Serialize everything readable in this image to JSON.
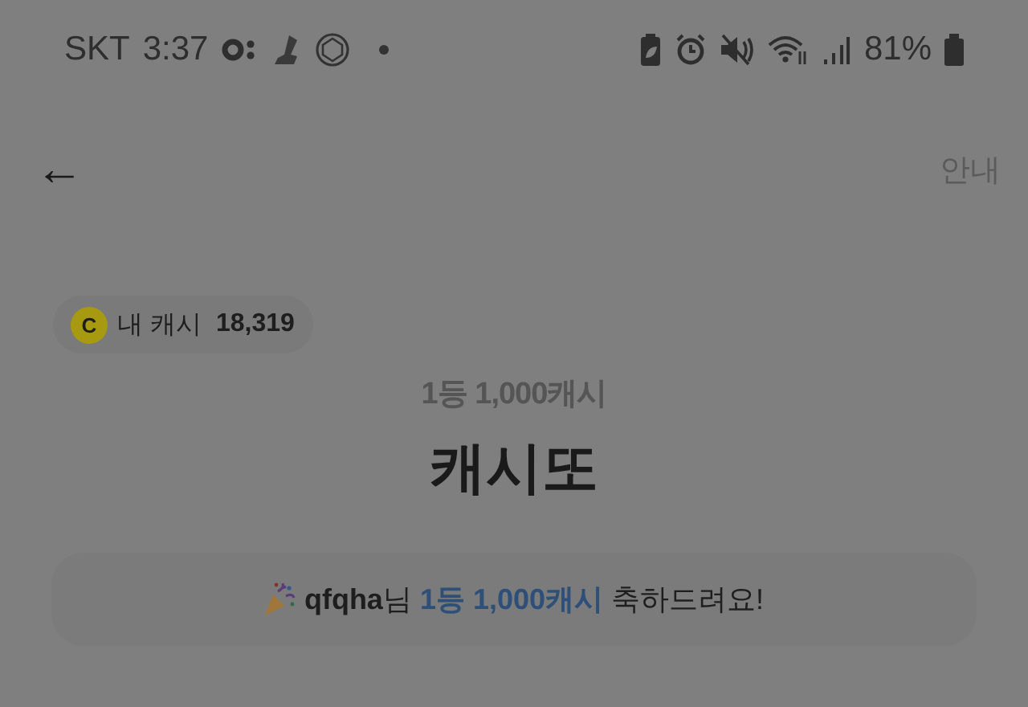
{
  "status_bar": {
    "carrier": "SKT",
    "time": "3:37",
    "battery_percent": "81%"
  },
  "header": {
    "back": "←",
    "info": "안내"
  },
  "cash_chip": {
    "coin": "C",
    "label": "내 캐시",
    "amount": "18,319"
  },
  "prize": {
    "subtitle": "1등 1,000캐시",
    "title": "캐시또"
  },
  "banner": {
    "parts": [
      {
        "text": "qfqha",
        "kind": "name"
      },
      {
        "text": "님 ",
        "kind": "plain"
      },
      {
        "text": "1등 1,000캐시",
        "kind": "prize"
      },
      {
        "text": " 축하드려요!",
        "kind": "plain"
      }
    ]
  }
}
